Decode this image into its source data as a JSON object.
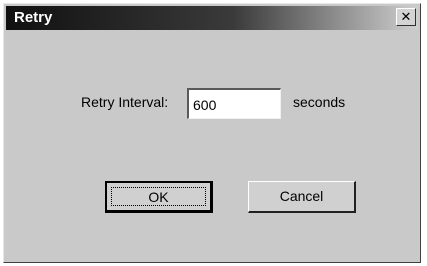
{
  "window": {
    "title": "Retry",
    "close_glyph": "✕"
  },
  "form": {
    "label": "Retry Interval:",
    "value": "600",
    "unit": "seconds"
  },
  "buttons": {
    "ok_label": "OK",
    "cancel_label": "Cancel"
  },
  "icons": {
    "close": "close-icon"
  }
}
